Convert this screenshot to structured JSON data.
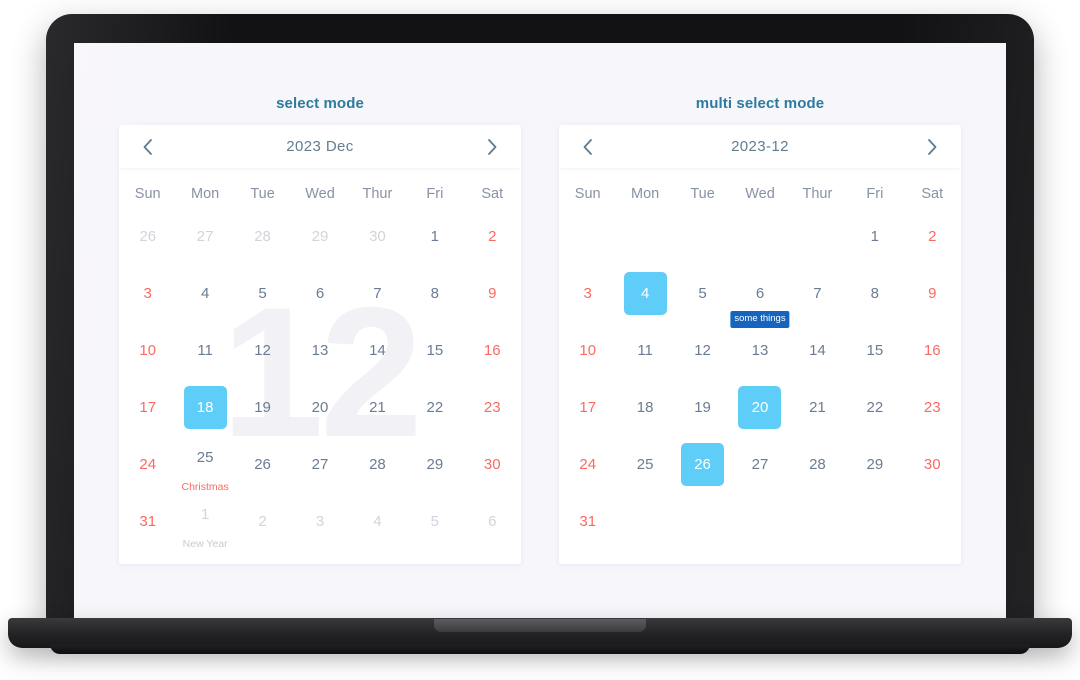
{
  "calendars": [
    {
      "title": "select mode",
      "header": {
        "prev_icon": "chevron-left-icon",
        "label": "2023  Dec",
        "next_icon": "chevron-right-icon"
      },
      "watermark": "12",
      "weekdays": [
        "Sun",
        "Mon",
        "Tue",
        "Wed",
        "Thur",
        "Fri",
        "Sat"
      ],
      "weeks": [
        [
          {
            "num": "26",
            "other": true
          },
          {
            "num": "27",
            "other": true
          },
          {
            "num": "28",
            "other": true
          },
          {
            "num": "29",
            "other": true
          },
          {
            "num": "30",
            "other": true
          },
          {
            "num": "1"
          },
          {
            "num": "2",
            "weekend": true
          }
        ],
        [
          {
            "num": "3",
            "weekend": true
          },
          {
            "num": "4"
          },
          {
            "num": "5"
          },
          {
            "num": "6"
          },
          {
            "num": "7"
          },
          {
            "num": "8"
          },
          {
            "num": "9",
            "weekend": true
          }
        ],
        [
          {
            "num": "10",
            "weekend": true
          },
          {
            "num": "11"
          },
          {
            "num": "12"
          },
          {
            "num": "13"
          },
          {
            "num": "14"
          },
          {
            "num": "15"
          },
          {
            "num": "16",
            "weekend": true
          }
        ],
        [
          {
            "num": "17",
            "weekend": true
          },
          {
            "num": "18",
            "selected": true
          },
          {
            "num": "19"
          },
          {
            "num": "20"
          },
          {
            "num": "21"
          },
          {
            "num": "22"
          },
          {
            "num": "23",
            "weekend": true
          }
        ],
        [
          {
            "num": "24",
            "weekend": true
          },
          {
            "num": "25",
            "label": "Christmas",
            "label_style": "holiday"
          },
          {
            "num": "26"
          },
          {
            "num": "27"
          },
          {
            "num": "28"
          },
          {
            "num": "29"
          },
          {
            "num": "30",
            "weekend": true
          }
        ],
        [
          {
            "num": "31",
            "weekend": true
          },
          {
            "num": "1",
            "other": true,
            "label": "New Year",
            "label_style": "muted"
          },
          {
            "num": "2",
            "other": true
          },
          {
            "num": "3",
            "other": true
          },
          {
            "num": "4",
            "other": true
          },
          {
            "num": "5",
            "other": true
          },
          {
            "num": "6",
            "other": true,
            "weekend": true
          }
        ]
      ]
    },
    {
      "title": "multi select mode",
      "header": {
        "prev_icon": "chevron-left-icon",
        "label": "2023-12",
        "next_icon": "chevron-right-icon"
      },
      "watermark": "",
      "weekdays": [
        "Sun",
        "Mon",
        "Tue",
        "Wed",
        "Thur",
        "Fri",
        "Sat"
      ],
      "weeks": [
        [
          {
            "num": ""
          },
          {
            "num": ""
          },
          {
            "num": ""
          },
          {
            "num": ""
          },
          {
            "num": ""
          },
          {
            "num": "1"
          },
          {
            "num": "2",
            "weekend": true
          }
        ],
        [
          {
            "num": "3",
            "weekend": true
          },
          {
            "num": "4",
            "selected": true
          },
          {
            "num": "5"
          },
          {
            "num": "6"
          },
          {
            "num": "7"
          },
          {
            "num": "8"
          },
          {
            "num": "9",
            "weekend": true
          }
        ],
        [
          {
            "num": "10",
            "weekend": true
          },
          {
            "num": "11"
          },
          {
            "num": "12"
          },
          {
            "num": "13",
            "badge": "some things"
          },
          {
            "num": "14"
          },
          {
            "num": "15"
          },
          {
            "num": "16",
            "weekend": true
          }
        ],
        [
          {
            "num": "17",
            "weekend": true
          },
          {
            "num": "18"
          },
          {
            "num": "19"
          },
          {
            "num": "20",
            "selected": true
          },
          {
            "num": "21"
          },
          {
            "num": "22"
          },
          {
            "num": "23",
            "weekend": true
          }
        ],
        [
          {
            "num": "24",
            "weekend": true
          },
          {
            "num": "25"
          },
          {
            "num": "26",
            "selected": true
          },
          {
            "num": "27"
          },
          {
            "num": "28"
          },
          {
            "num": "29"
          },
          {
            "num": "30",
            "weekend": true
          }
        ],
        [
          {
            "num": "31",
            "weekend": true
          },
          {
            "num": ""
          },
          {
            "num": ""
          },
          {
            "num": ""
          },
          {
            "num": ""
          },
          {
            "num": ""
          },
          {
            "num": "",
            "weekend": true
          }
        ]
      ]
    }
  ],
  "colors": {
    "page_background": "#f7f6fb",
    "card_background": "#ffffff",
    "title": "#2d7b9e",
    "header_text": "#627d8f",
    "weekday": "#8892a4",
    "weekday_num": "#6b7c92",
    "weekend": "#fb6a61",
    "other_month": "#d2d4dc",
    "selected": "#5ecdf7",
    "badge": "#1565c0",
    "watermark": "#f1f1f6",
    "laptop_frame": "#121214"
  }
}
